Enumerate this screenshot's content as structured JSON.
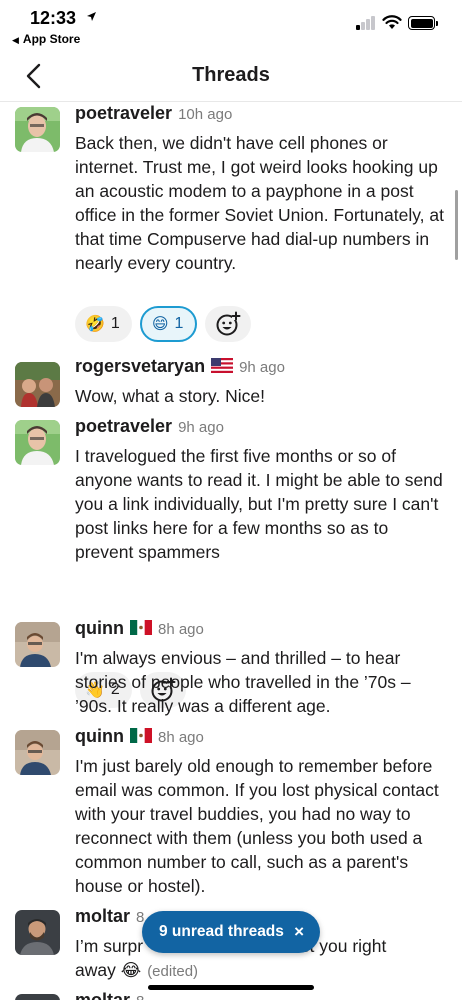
{
  "status_bar": {
    "time": "12:33",
    "location_arrow": "➤",
    "back_app": "App Store",
    "back_triangle": "◀"
  },
  "header": {
    "title": "Threads",
    "back_icon": "chevron-left-icon"
  },
  "messages": [
    {
      "user": "poetraveler",
      "time": "10h ago",
      "text": "Back then, we didn't have cell phones or internet. Trust me, I got weird looks hooking up an acoustic modem to a payphone in a post office in the former Soviet Union. Fortunately, at that time Compuserve had dial-up numbers in nearly every country.",
      "reactions": [
        {
          "emoji": "🤣",
          "count": "1",
          "selected": false
        },
        {
          "emoji": "😄",
          "count": "1",
          "selected": true
        }
      ]
    },
    {
      "user": "rogersvetaryan",
      "flag": "🇺🇸",
      "time": "9h ago",
      "text": "Wow, what a story. Nice!"
    },
    {
      "user": "poetraveler",
      "time": "9h ago",
      "text": "I travelogued the first five months or so of anyone wants to read it. I might be able to send you a link individually, but I'm pretty sure I can't post links here for a few months so as to prevent spammers",
      "reactions": [
        {
          "emoji": "👋",
          "count": "2",
          "selected": false
        }
      ]
    },
    {
      "user": "quinn",
      "flag": "🇲🇽",
      "time": "8h ago",
      "text": "I'm always envious – and thrilled – to hear stories of people who travelled in the ’70s – ’90s. It really was a different age."
    },
    {
      "user": "quinn",
      "flag": "🇲🇽",
      "time": "8h ago",
      "text": "I'm just barely old enough to remember before email was common. If you lost physical contact with your travel buddies, you had no way to reconnect with them (unless you both used a common number to call, such as a parent's house or hostel)."
    },
    {
      "user": "moltar",
      "time": "8",
      "text_start": "I’m surpr",
      "text_end": "est you right",
      "text_line2": "away",
      "emoji": "😂",
      "edited": "(edited)"
    },
    {
      "user": "moltar",
      "time": "8"
    }
  ],
  "unread_pill": {
    "label": "9 unread threads",
    "close": "×"
  },
  "colors": {
    "accent": "#1264a3",
    "selected_reaction_border": "#1d9bd1",
    "text": "#1d1c1d",
    "muted": "#7b7b7b"
  }
}
